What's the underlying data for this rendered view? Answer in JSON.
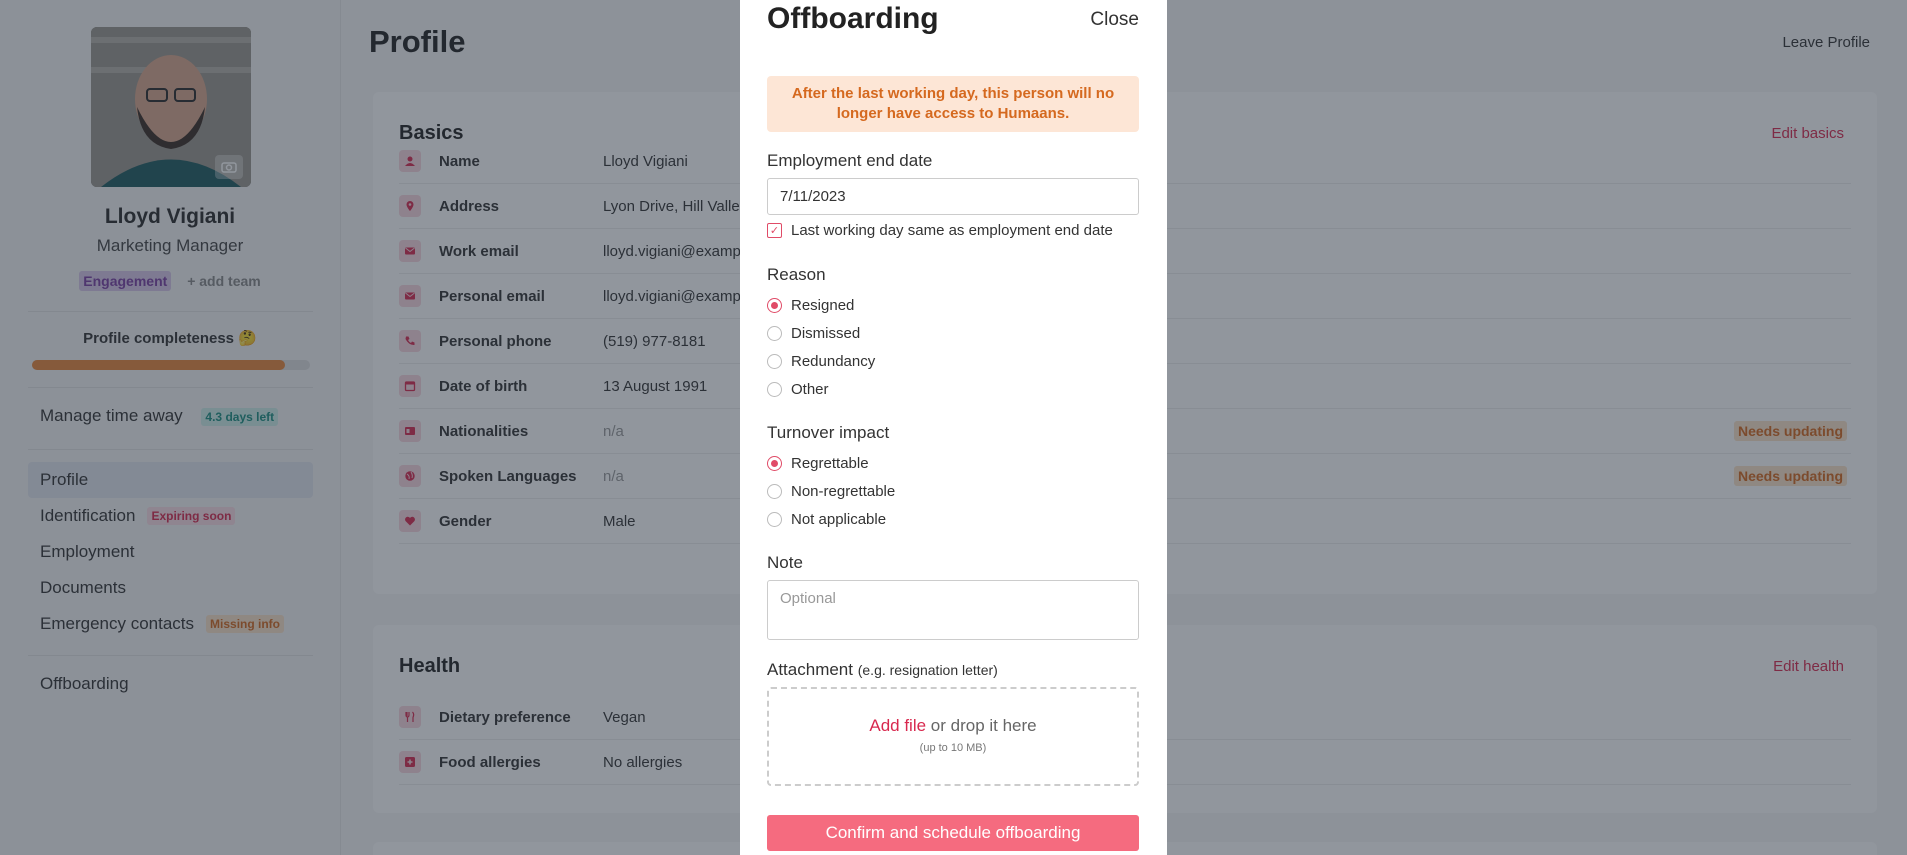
{
  "sidebar": {
    "person_name": "Lloyd Vigiani",
    "person_role": "Marketing Manager",
    "team_tag": "Engagement",
    "add_team": "+ add team",
    "completeness_label": "Profile completeness 🤔",
    "completeness_fraction": 0.91,
    "time_away_label": "Manage time away",
    "days_left_badge": "4.3 days left",
    "nav": [
      {
        "label": "Profile",
        "badge": ""
      },
      {
        "label": "Identification",
        "badge": "Expiring soon"
      },
      {
        "label": "Employment",
        "badge": ""
      },
      {
        "label": "Documents",
        "badge": ""
      },
      {
        "label": "Emergency contacts",
        "badge": "Missing info"
      }
    ],
    "offboarding": "Offboarding"
  },
  "main": {
    "page_title": "Profile",
    "leave_profile": "Leave Profile",
    "basics": {
      "title": "Basics",
      "edit": "Edit basics",
      "rows": [
        {
          "label": "Name",
          "value": "Lloyd Vigiani",
          "icon": "person-icon"
        },
        {
          "label": "Address",
          "value": "Lyon Drive, Hill Valle",
          "icon": "pin-icon"
        },
        {
          "label": "Work email",
          "value": "lloyd.vigiani@examp",
          "icon": "mail-icon"
        },
        {
          "label": "Personal email",
          "value": "lloyd.vigiani@examp",
          "icon": "mail-icon"
        },
        {
          "label": "Personal phone",
          "value": "(519) 977-8181",
          "icon": "phone-icon"
        },
        {
          "label": "Date of birth",
          "value": "13 August 1991",
          "icon": "calendar-icon"
        },
        {
          "label": "Nationalities",
          "value": "n/a",
          "icon": "passport-icon",
          "status": "Needs updating"
        },
        {
          "label": "Spoken Languages",
          "value": "n/a",
          "icon": "globe-icon",
          "status": "Needs updating"
        },
        {
          "label": "Gender",
          "value": "Male",
          "icon": "heart-icon"
        }
      ]
    },
    "health": {
      "title": "Health",
      "edit": "Edit health",
      "rows": [
        {
          "label": "Dietary preference",
          "value": "Vegan",
          "icon": "fork-icon"
        },
        {
          "label": "Food allergies",
          "value": "No allergies",
          "icon": "medical-icon"
        }
      ]
    }
  },
  "modal": {
    "title": "Offboarding",
    "close": "Close",
    "warning": "After the last working day, this person will no longer have access to Humaans.",
    "end_date_label": "Employment end date",
    "end_date_value": "7/11/2023",
    "last_day_checkbox": "Last working day same as employment end date",
    "reason_label": "Reason",
    "reasons": [
      "Resigned",
      "Dismissed",
      "Redundancy",
      "Other"
    ],
    "reason_selected": "Resigned",
    "turnover_label": "Turnover impact",
    "turnover_options": [
      "Regrettable",
      "Non-regrettable",
      "Not applicable"
    ],
    "turnover_selected": "Regrettable",
    "note_label": "Note",
    "note_placeholder": "Optional",
    "attachment_label": "Attachment",
    "attachment_hint": "(e.g. resignation letter)",
    "add_file": "Add file",
    "drop_text": "or drop it here",
    "size_hint": "(up to 10 MB)",
    "confirm": "Confirm and schedule offboarding"
  },
  "colors": {
    "accent": "#e04b67",
    "warning": "#d5691f",
    "confirm_button": "#f56b7f"
  }
}
